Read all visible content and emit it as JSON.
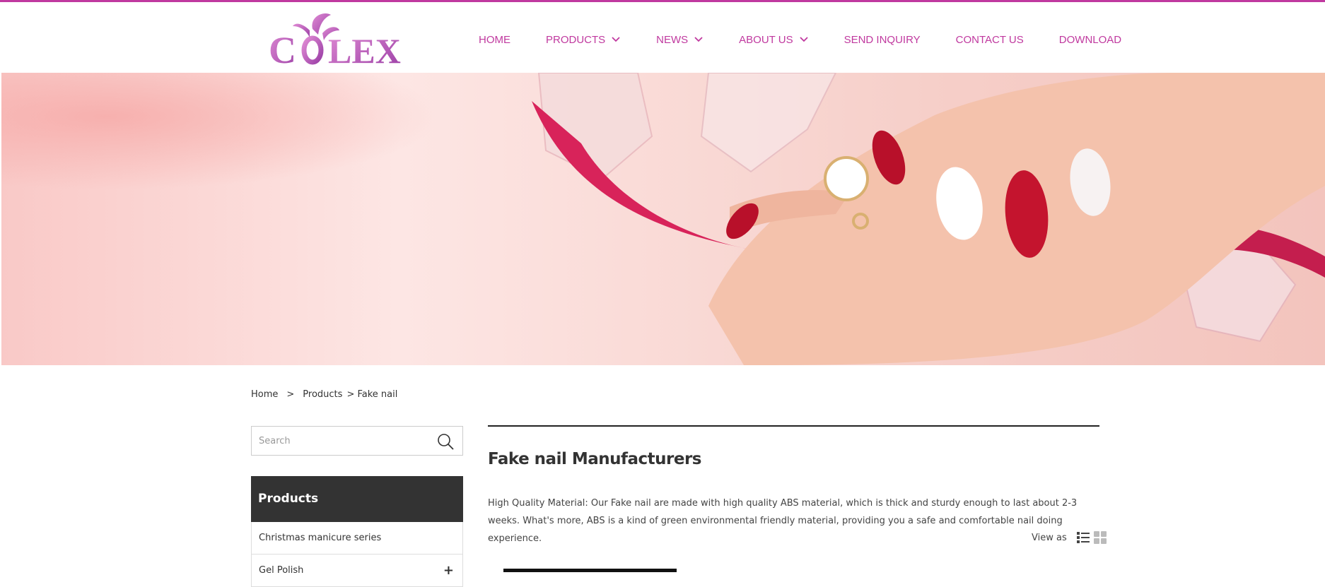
{
  "brand": {
    "logo_text": "COLEX",
    "accent_color": "#c0399f"
  },
  "nav": {
    "items": [
      {
        "label": "HOME",
        "has_dropdown": false
      },
      {
        "label": "PRODUCTS",
        "has_dropdown": true
      },
      {
        "label": "NEWS",
        "has_dropdown": true
      },
      {
        "label": "ABOUT US",
        "has_dropdown": true
      },
      {
        "label": "SEND INQUIRY",
        "has_dropdown": false
      },
      {
        "label": "CONTACT US",
        "has_dropdown": false
      },
      {
        "label": "DOWNLOAD",
        "has_dropdown": false
      }
    ]
  },
  "breadcrumb": {
    "home": "Home",
    "sep": ">",
    "products": "Products",
    "current": "> Fake nail"
  },
  "search": {
    "placeholder": "Search",
    "value": ""
  },
  "sidebar": {
    "heading": "Products",
    "items": [
      {
        "label": "Christmas manicure series",
        "expandable": false
      },
      {
        "label": "Gel Polish",
        "expandable": true
      }
    ]
  },
  "main": {
    "title": "Fake nail Manufacturers",
    "description": "High Quality Material: Our Fake nail are made with high quality ABS material, which is thick and sturdy enough to last about 2-3 weeks. What's more, ABS is a kind of green environmental friendly material, providing you a safe and comfortable nail doing experience.",
    "view_as_label": "View as",
    "view_modes": [
      "list-view-icon",
      "grid-view-icon"
    ]
  }
}
